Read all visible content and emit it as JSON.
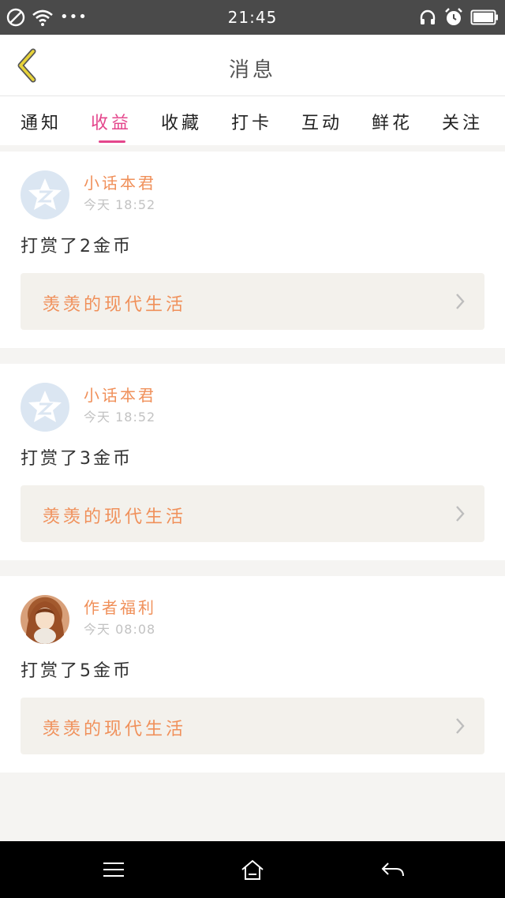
{
  "status_bar": {
    "time": "21:45",
    "left_icons": [
      "no-disturb-icon",
      "wifi-icon",
      "more-dots-icon"
    ],
    "more_dots": "•••",
    "right_icons": [
      "headset-icon",
      "alarm-icon",
      "battery-icon"
    ]
  },
  "header": {
    "title": "消息",
    "back_icon": "chevron-left-icon"
  },
  "tabs": [
    {
      "label": "通知",
      "active": false
    },
    {
      "label": "收益",
      "active": true
    },
    {
      "label": "收藏",
      "active": false
    },
    {
      "label": "打卡",
      "active": false
    },
    {
      "label": "互动",
      "active": false
    },
    {
      "label": "鲜花",
      "active": false
    },
    {
      "label": "关注",
      "active": false
    }
  ],
  "messages": [
    {
      "username": "小话本君",
      "time": "今天 18:52",
      "text": "打赏了2金币",
      "book_title": "羡羡的现代生活",
      "avatar": "default-avatar"
    },
    {
      "username": "小话本君",
      "time": "今天 18:52",
      "text": "打赏了3金币",
      "book_title": "羡羡的现代生活",
      "avatar": "default-avatar"
    },
    {
      "username": "作者福利",
      "time": "今天 08:08",
      "text": "打赏了5金币",
      "book_title": "羡羡的现代生活",
      "avatar": "photo-avatar"
    }
  ],
  "nav_bar": {
    "icons": [
      "menu-icon",
      "home-icon",
      "back-arrow-icon"
    ]
  },
  "colors": {
    "accent": "#e4468c",
    "orange_text": "#f0905a",
    "status_bar": "#4a4a4a",
    "back_icon": "#e7d33a"
  }
}
